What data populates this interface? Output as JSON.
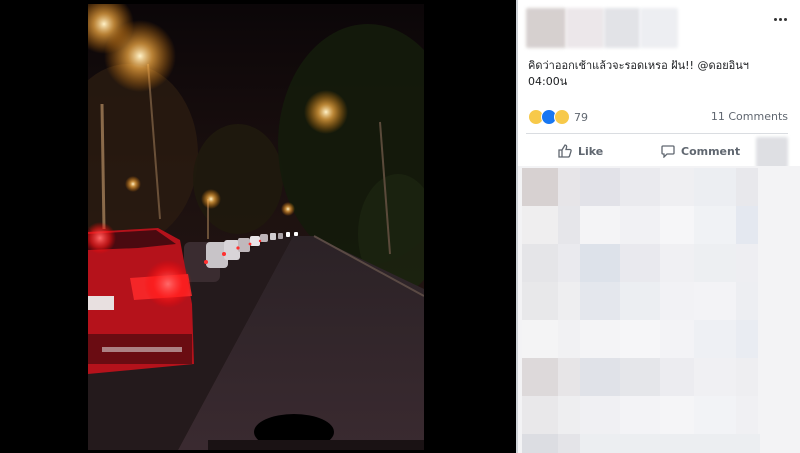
{
  "post": {
    "text": "คิดว่าออกเช้าแล้วจะรอดเหรอ ฝัน!! @ดอยอินฯ 04:00น",
    "reaction_count": "79",
    "reaction_icons": [
      "haha-reaction-icon",
      "like-reaction-icon",
      "wow-reaction-icon"
    ],
    "comments_label": "11 Comments",
    "like_label": "Like",
    "comment_label": "Comment"
  },
  "photo": {
    "description_colors": {
      "sky": "#050408",
      "road": "#2a1d1f",
      "taillight": "#ff2a2a",
      "streetlight": "#ffd89a"
    }
  },
  "colors": {
    "accent": "#1877f2",
    "panel_bg": "#ffffff",
    "muted_text": "#606770"
  }
}
